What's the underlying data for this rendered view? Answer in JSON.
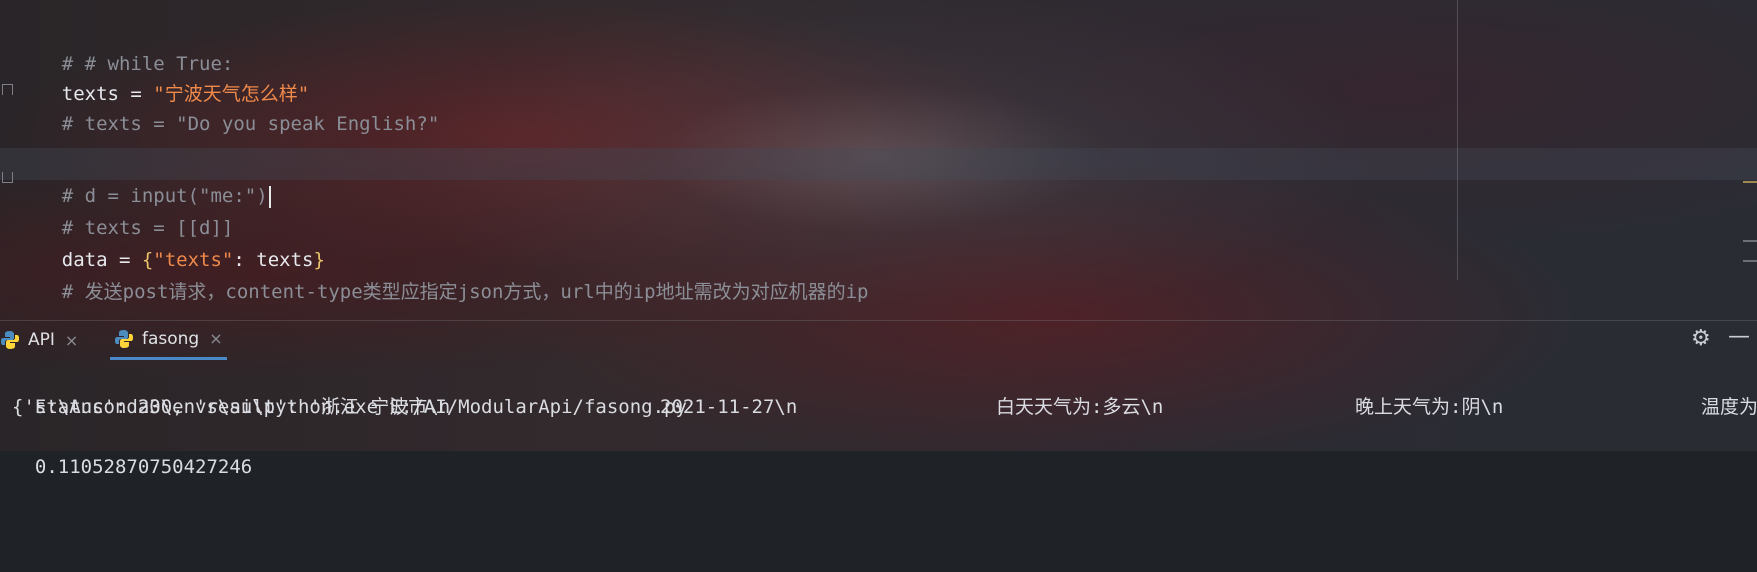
{
  "editor": {
    "lines": [
      {
        "kind": "comment",
        "text": "# # while True:"
      },
      {
        "kind": "assign_str",
        "name": "texts = ",
        "value": "\"宁波天气怎么样\""
      },
      {
        "kind": "comment",
        "text": "# texts = \"Do you speak English?\""
      },
      {
        "kind": "blank",
        "text": ""
      },
      {
        "kind": "comment",
        "text": "# d = input(\"me:\")"
      },
      {
        "kind": "comment",
        "text": "# texts = [[d]]"
      },
      {
        "kind": "dict",
        "prefix": "data = ",
        "open": "{",
        "key": "\"texts\"",
        "sep": ": ",
        "val": "texts",
        "close": "}"
      },
      {
        "kind": "comment",
        "text": "# 发送post请求，content-type类型应指定json方式，url中的ip地址需改为对应机器的ip"
      }
    ]
  },
  "run_panel": {
    "tabs": [
      {
        "label": "API",
        "close": "×"
      },
      {
        "label": "fasong",
        "close": "×",
        "active": true
      }
    ],
    "settings_icon": "gear-icon",
    "minimize_icon": "minimize-icon",
    "settings_glyph": "⚙",
    "minimize_glyph": "—",
    "console": {
      "command": "E:\\Anconda3\\envs\\ai\\python.exe E:/AI/ModularApi/fasong.py",
      "result_segments": [
        "{'status': 200, 'result': '浙江 宁波市\\n",
        "2021-11-27\\n",
        "白天天气为:多云\\n",
        "晚上天气为:阴\\n",
        "温度为"
      ],
      "timing": "0.11052870750427246"
    }
  },
  "colors": {
    "comment": "#8b8e96",
    "string": "#ef8a4a",
    "brace": "#e9c46a",
    "tab_active_underline": "#4a88c7"
  }
}
